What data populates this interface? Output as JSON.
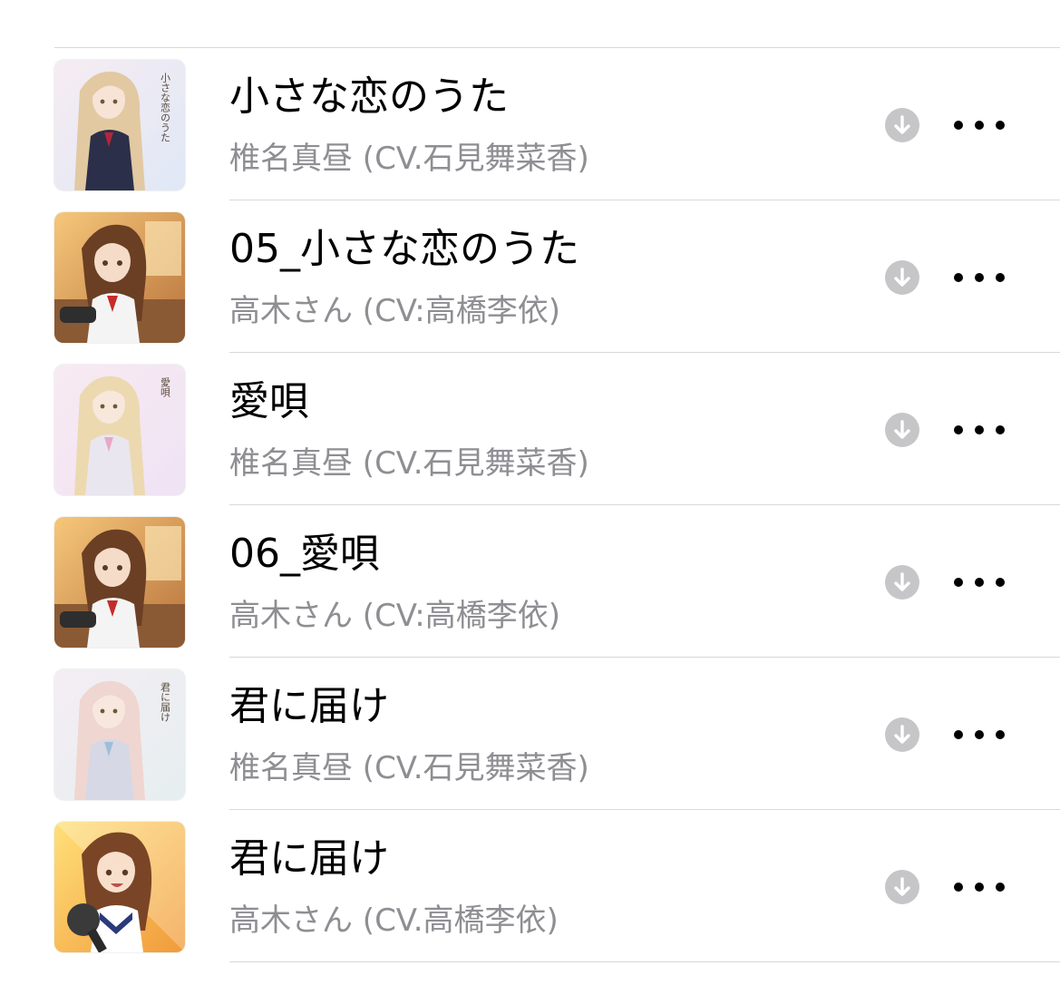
{
  "colors": {
    "title_text": "#000000",
    "artist_text": "#8e8e93",
    "download_icon_bg": "#c6c6c8",
    "divider": "#d9d9d9"
  },
  "icons": {
    "download": "download-arrow-circle-icon",
    "more": "ellipsis-icon"
  },
  "songs": [
    {
      "title": "小さな恋のうた",
      "artist": "椎名真昼 (CV.石見舞菜香)",
      "artwork": {
        "style": "mahiru",
        "cover_text": "小さな恋のうた",
        "bg": [
          "#f6ecf2",
          "#dfe8f6"
        ],
        "hair": "#e2c9a2",
        "skin": "#f7e4d6",
        "outfit": "#2b2f4a",
        "accent": "#b3263a"
      }
    },
    {
      "title": "05_小さな恋のうた",
      "artist": "高木さん (CV:高橋李依)",
      "artwork": {
        "style": "takagi",
        "cover_text": "",
        "bg": [
          "#f6c77a",
          "#b8733c"
        ],
        "hair": "#6b3f24",
        "skin": "#f5dcc8",
        "outfit": "#f4f4f4",
        "accent": "#c62b2b"
      }
    },
    {
      "title": "愛唄",
      "artist": "椎名真昼 (CV.石見舞菜香)",
      "artwork": {
        "style": "mahiru",
        "cover_text": "愛唄",
        "bg": [
          "#f8eaf2",
          "#efe3f4"
        ],
        "hair": "#ecd9b0",
        "skin": "#f8e7db",
        "outfit": "#e9e6ef",
        "accent": "#e7a9c3"
      }
    },
    {
      "title": "06_愛唄",
      "artist": "高木さん (CV:高橋李依)",
      "artwork": {
        "style": "takagi",
        "cover_text": "",
        "bg": [
          "#f6c77a",
          "#b8733c"
        ],
        "hair": "#6b3f24",
        "skin": "#f5dcc8",
        "outfit": "#f4f4f4",
        "accent": "#c62b2b"
      }
    },
    {
      "title": "君に届け",
      "artist": "椎名真昼 (CV.石見舞菜香)",
      "artwork": {
        "style": "mahiru",
        "cover_text": "君に届け",
        "bg": [
          "#f4eef4",
          "#e6eef0"
        ],
        "hair": "#efd6d0",
        "skin": "#f8e7dd",
        "outfit": "#d6d8e6",
        "accent": "#9fbfd9"
      }
    },
    {
      "title": "君に届け",
      "artist": "高木さん (CV.高橋李依)",
      "artwork": {
        "style": "takagi-mic",
        "cover_text": "",
        "bg": [
          "#ffe07a",
          "#f19a3a"
        ],
        "hair": "#7a4526",
        "skin": "#f7dfcc",
        "outfit": "#ffffff",
        "accent": "#2a3a7a"
      }
    }
  ]
}
